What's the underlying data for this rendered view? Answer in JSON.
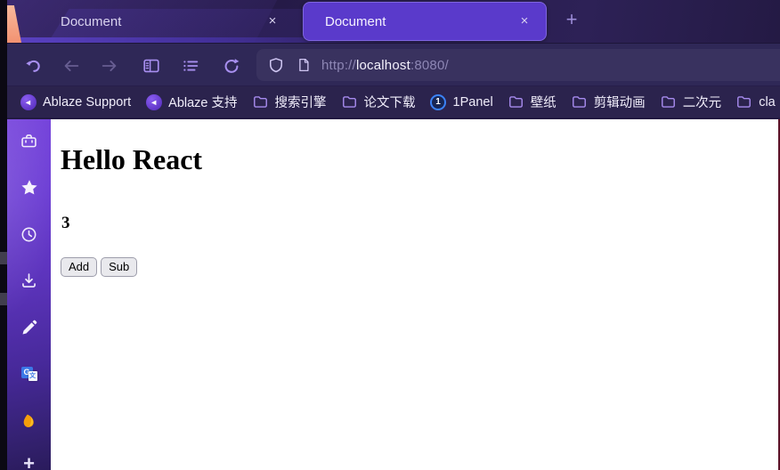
{
  "theme": {
    "accent_purple": "#6b3fd6",
    "active_tab_bg": "#5a3acb",
    "chrome_bg": "#2f2857",
    "tabbar_bg": "#241a46",
    "bookmarks_bg": "#2b234d",
    "peach_accent": "#f6a684",
    "toolbar_icon": "#a88ff0",
    "content_bg": "#ffffff",
    "right_edge_line": "#5c1228"
  },
  "tabs": [
    {
      "label": "Document",
      "close_glyph": "×",
      "state": "inactive"
    },
    {
      "label": "Document",
      "close_glyph": "×",
      "state": "active"
    }
  ],
  "tabbar": {
    "new_tab_glyph": "+"
  },
  "toolbar": {
    "url": {
      "scheme": "http://",
      "host": "localhost",
      "rest": ":8080/"
    }
  },
  "bookmarks": [
    {
      "label": "Ablaze Support",
      "icon": "floorp-logo"
    },
    {
      "label": "Ablaze 支持",
      "icon": "floorp-logo"
    },
    {
      "label": "搜索引擎",
      "icon": "folder"
    },
    {
      "label": "论文下载",
      "icon": "folder"
    },
    {
      "label": "1Panel",
      "icon": "1panel-logo"
    },
    {
      "label": "壁纸",
      "icon": "folder"
    },
    {
      "label": "剪辑动画",
      "icon": "folder"
    },
    {
      "label": "二次元",
      "icon": "folder"
    },
    {
      "label": "cla",
      "icon": "folder"
    }
  ],
  "icon_glyphs": {
    "floorp": "◄",
    "onepanel": "1",
    "translate_g": "G",
    "translate_t": "文",
    "sidebar_plus": "+"
  },
  "sidebar": {
    "icons": [
      "briefcase",
      "star",
      "clock",
      "download",
      "pencil",
      "translate",
      "flame",
      "plus"
    ]
  },
  "page": {
    "heading": "Hello React",
    "counter": "3",
    "buttons": {
      "add": "Add",
      "sub": "Sub"
    }
  }
}
